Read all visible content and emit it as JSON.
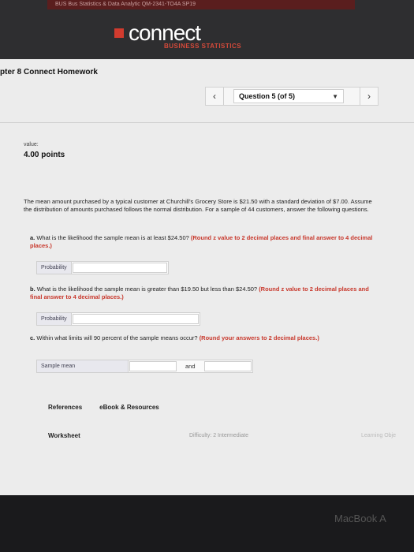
{
  "browser": {
    "tab_text": "BUS Bus Statistics & Data Analytic QM-2341-TO4A SP19"
  },
  "app": {
    "logo": "connect",
    "subtitle": "BUSINESS STATISTICS",
    "header_title": "pter 8 Connect Homework"
  },
  "nav": {
    "prev_icon": "‹",
    "next_icon": "›",
    "question_label": "Question 5 (of 5)",
    "caret": "▼"
  },
  "question": {
    "value_label": "value:",
    "points": "4.00 points",
    "body": "The mean amount purchased by a typical customer at Churchill's Grocery Store is $21.50 with a standard deviation of $7.00. Assume the distribution of amounts purchased follows the normal distribution. For a sample of 44 customers, answer the following questions.",
    "parts": [
      {
        "prefix": "a. ",
        "text": "What is the likelihood the sample mean is at least $24.50? ",
        "instruction": "(Round z value to 2 decimal places and final answer to 4 decimal places.)",
        "field_label": "Probability"
      },
      {
        "prefix": "b. ",
        "text": "What is the likelihood the sample mean is greater than $19.50 but less than $24.50? ",
        "instruction": "(Round z value to 2 decimal places and final answer to 4 decimal places.)",
        "field_label": "Probability"
      },
      {
        "prefix": "c. ",
        "text": "Within what limits will 90 percent of the sample means occur? ",
        "instruction": "(Round your answers to 2 decimal places.)",
        "field_label": "Sample mean",
        "and_label": "and"
      }
    ]
  },
  "resources": {
    "references": "References",
    "ebook": "eBook & Resources"
  },
  "worksheet": {
    "label": "Worksheet",
    "difficulty": "Difficulty: 2 Intermediate",
    "learning": "Learning Obje"
  },
  "device": {
    "brand": "MacBook A"
  }
}
